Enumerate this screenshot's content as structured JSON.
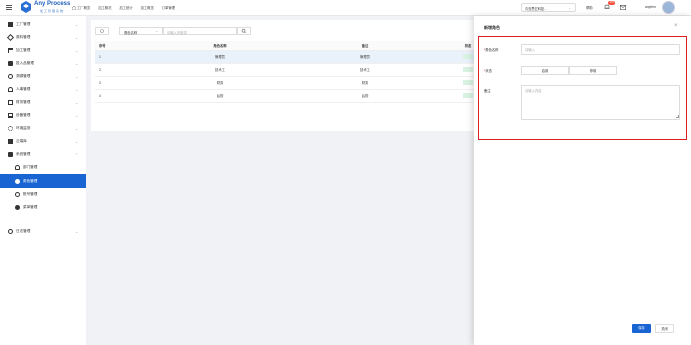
{
  "header": {
    "brand": "Any Process",
    "brand_sub": "加工管理系统",
    "nav": [
      "工厂概览",
      "加工概况",
      "加工统计",
      "加工概览",
      "订单管理"
    ],
    "factory_select": "青岛思亿科技...",
    "help": "帮助",
    "badge": "176",
    "user": "anyfem"
  },
  "sidebar": {
    "items": [
      {
        "label": "工厂管理",
        "icon": "grid-icon"
      },
      {
        "label": "原料管理",
        "icon": "tools-icon"
      },
      {
        "label": "加工管理",
        "icon": "hammer-icon"
      },
      {
        "label": "投入品管理",
        "icon": "box-icon"
      },
      {
        "label": "溯源管理",
        "icon": "trace-icon"
      },
      {
        "label": "人事管理",
        "icon": "person-icon"
      },
      {
        "label": "财务管理",
        "icon": "wallet-icon"
      },
      {
        "label": "设备管理",
        "icon": "monitor-icon"
      },
      {
        "label": "环境监测",
        "icon": "gear-icon"
      },
      {
        "label": "云端库",
        "icon": "book-icon"
      },
      {
        "label": "系统管理",
        "icon": "computer-icon"
      },
      {
        "label": "部门管理",
        "icon": "dept-icon"
      },
      {
        "label": "角色管理",
        "icon": "role-icon"
      },
      {
        "label": "账号管理",
        "icon": "account-icon"
      },
      {
        "label": "菜单管理",
        "icon": "menu-icon"
      },
      {
        "label": "日志管理",
        "icon": "log-icon"
      }
    ]
  },
  "toolbar": {
    "filter_select": "角色名称",
    "search_placeholder": "请输入关键词"
  },
  "table": {
    "headers": [
      "序号",
      "角色名称",
      "备注",
      "状态"
    ],
    "rows": [
      {
        "no": "1",
        "name": "管理员",
        "note": "管理员"
      },
      {
        "no": "2",
        "name": "技术工",
        "note": "技术工"
      },
      {
        "no": "3",
        "name": "财务",
        "note": "财务"
      },
      {
        "no": "4",
        "name": "后勤",
        "note": "后勤"
      }
    ]
  },
  "drawer": {
    "title": "新增角色",
    "name_label": "角色名称",
    "name_placeholder": "请输入",
    "status_label": "状态",
    "status_options": [
      "启用",
      "停用"
    ],
    "note_label": "备注",
    "note_placeholder": "请输入内容",
    "save": "保存",
    "close": "关闭"
  }
}
